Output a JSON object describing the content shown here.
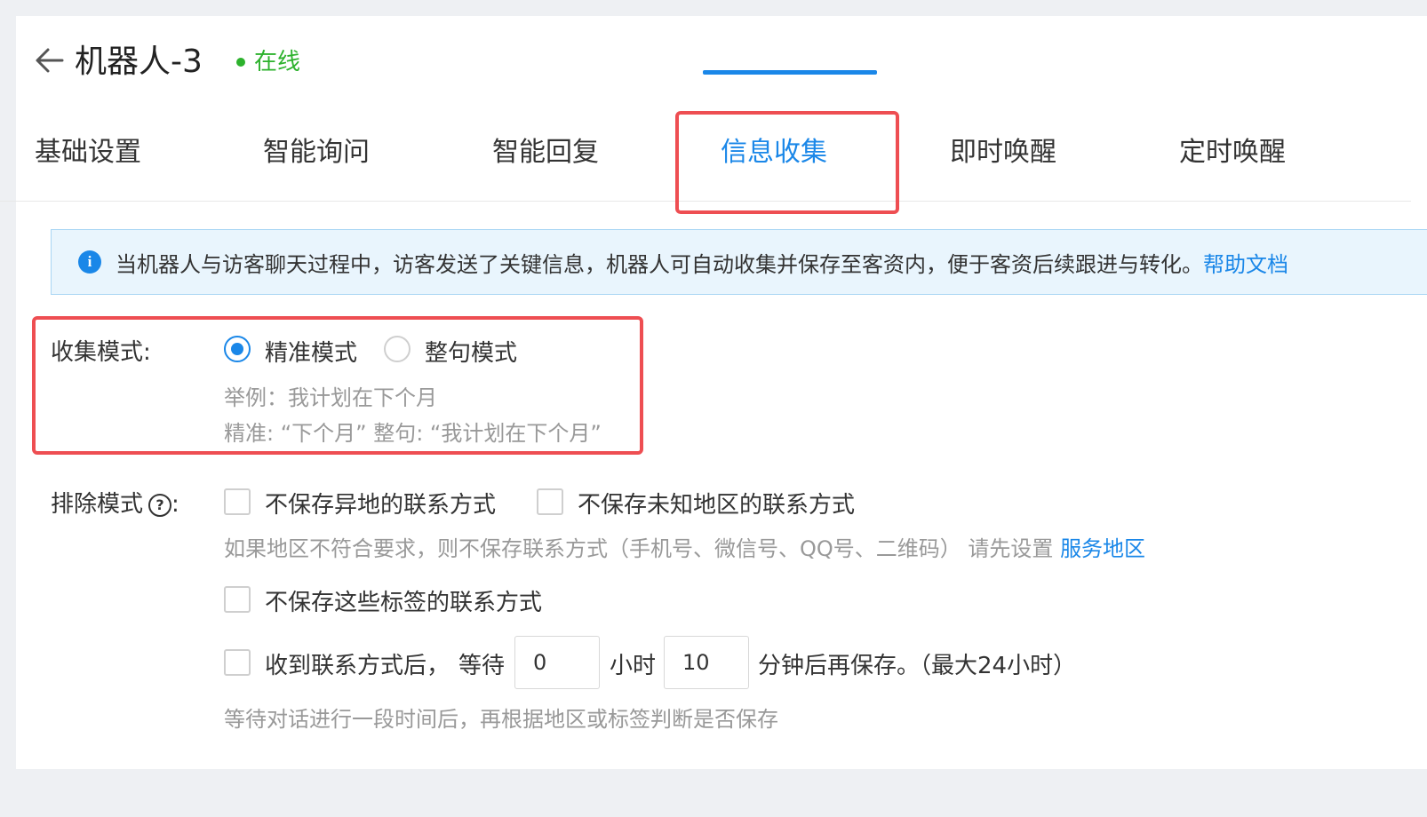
{
  "header": {
    "title": "机器人-3",
    "status": "在线",
    "status_color": "#2db22d"
  },
  "tabs": [
    {
      "label": "基础设置",
      "active": false
    },
    {
      "label": "智能询问",
      "active": false
    },
    {
      "label": "智能回复",
      "active": false
    },
    {
      "label": "信息收集",
      "active": true
    },
    {
      "label": "即时唤醒",
      "active": false
    },
    {
      "label": "定时唤醒",
      "active": false
    }
  ],
  "banner": {
    "text": "当机器人与访客聊天过程中，访客发送了关键信息，机器人可自动收集并保存至客资内，便于客资后续跟进与转化。",
    "link": "帮助文档"
  },
  "collect_mode": {
    "label": "收集模式:",
    "options": [
      {
        "label": "精准模式",
        "selected": true
      },
      {
        "label": "整句模式",
        "selected": false
      }
    ],
    "example_line1": "举例：我计划在下个月",
    "example_line2": "精准: “下个月” 整句: “我计划在下个月”"
  },
  "exclude_mode": {
    "label": "排除模式",
    "help_icon": "?",
    "colon": ":",
    "option_remote": "不保存异地的联系方式",
    "option_unknown_region": "不保存未知地区的联系方式",
    "region_hint": "如果地区不符合要求，则不保存联系方式（手机号、微信号、QQ号、二维码） 请先设置",
    "region_link": "服务地区",
    "option_tags": "不保存这些标签的联系方式",
    "delay_prefix": "收到联系方式后，",
    "delay_wait": "等待",
    "hours_value": "0",
    "hours_unit": "小时",
    "minutes_value": "10",
    "minutes_suffix": "分钟后再保存。（最大24小时）",
    "delay_hint": "等待对话进行一段时间后，再根据地区或标签判断是否保存"
  },
  "colors": {
    "accent": "#1a87e8",
    "highlight_border": "#ee4e52"
  }
}
